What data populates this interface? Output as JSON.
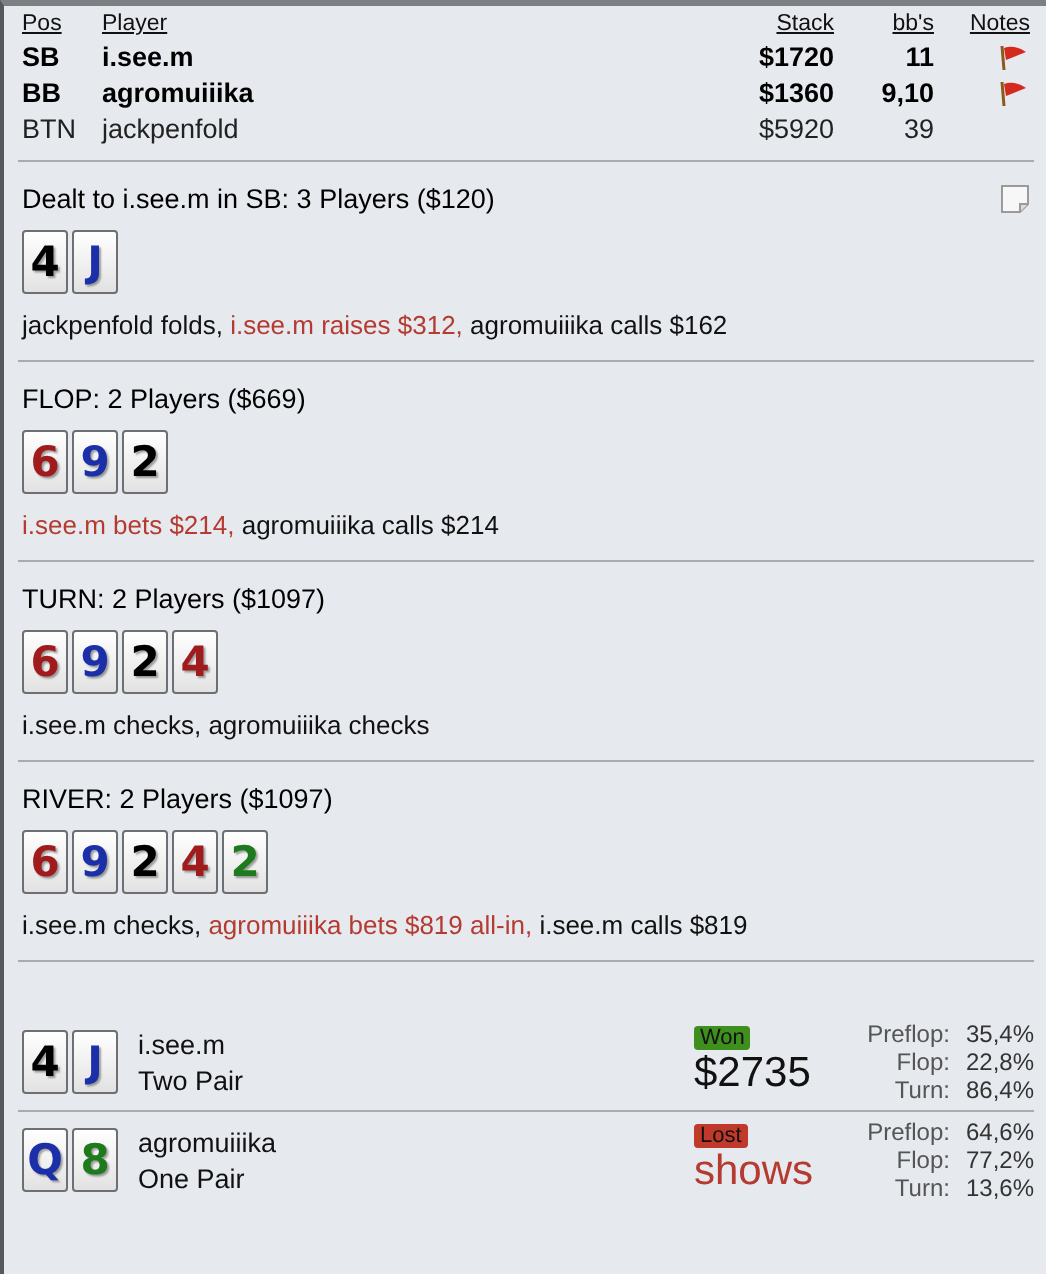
{
  "players_table": {
    "columns": [
      "Pos",
      "Player",
      "Stack",
      "bb's",
      "Notes"
    ],
    "rows": [
      {
        "pos": "SB",
        "player": "i.see.m",
        "stack": "$1720",
        "bbs": "11",
        "highlighted": true,
        "note": true
      },
      {
        "pos": "BB",
        "player": "agromuiiika",
        "stack": "$1360",
        "bbs": "9,10",
        "highlighted": true,
        "note": true
      },
      {
        "pos": "BTN",
        "player": "jackpenfold",
        "stack": "$5920",
        "bbs": "39",
        "highlighted": false,
        "note": false
      }
    ]
  },
  "streets": [
    {
      "heading": "Dealt to i.see.m in SB: 3 Players ($120)",
      "note_icon": true,
      "cards": [
        {
          "rank": "4",
          "color": "#000000"
        },
        {
          "rank": "J",
          "color": "#1a2fa8"
        }
      ],
      "actions": [
        {
          "text": "jackpenfold folds, ",
          "highlighted": false
        },
        {
          "text": "i.see.m raises $312,",
          "highlighted": true
        },
        {
          "text": " agromuiiika calls $162",
          "highlighted": false
        }
      ]
    },
    {
      "heading": "FLOP: 2 Players ($669)",
      "note_icon": false,
      "cards": [
        {
          "rank": "6",
          "color": "#a01c1c"
        },
        {
          "rank": "9",
          "color": "#1a2fa8"
        },
        {
          "rank": "2",
          "color": "#000000"
        }
      ],
      "actions": [
        {
          "text": "i.see.m bets $214,",
          "highlighted": true
        },
        {
          "text": " agromuiiika calls $214",
          "highlighted": false
        }
      ]
    },
    {
      "heading": "TURN: 2 Players ($1097)",
      "note_icon": false,
      "cards": [
        {
          "rank": "6",
          "color": "#a01c1c"
        },
        {
          "rank": "9",
          "color": "#1a2fa8"
        },
        {
          "rank": "2",
          "color": "#000000"
        },
        {
          "rank": "4",
          "color": "#a01c1c"
        }
      ],
      "actions": [
        {
          "text": "i.see.m checks, agromuiiika checks",
          "highlighted": false
        }
      ]
    },
    {
      "heading": "RIVER: 2 Players ($1097)",
      "note_icon": false,
      "cards": [
        {
          "rank": "6",
          "color": "#a01c1c"
        },
        {
          "rank": "9",
          "color": "#1a2fa8"
        },
        {
          "rank": "2",
          "color": "#000000"
        },
        {
          "rank": "4",
          "color": "#a01c1c"
        },
        {
          "rank": "2",
          "color": "#1d7a1d"
        }
      ],
      "actions": [
        {
          "text": "i.see.m checks, ",
          "highlighted": false
        },
        {
          "text": "agromuiiika bets $819 all-in,",
          "highlighted": true
        },
        {
          "text": " i.see.m calls $819",
          "highlighted": false
        }
      ]
    }
  ],
  "results": [
    {
      "cards": [
        {
          "rank": "4",
          "color": "#000000"
        },
        {
          "rank": "J",
          "color": "#1a2fa8"
        }
      ],
      "player": "i.see.m",
      "hand": "Two Pair",
      "result": {
        "kind": "won",
        "label": "Won"
      },
      "amount": "$2735",
      "equity": [
        {
          "label": "Preflop:",
          "value": "35,4%"
        },
        {
          "label": "Flop:",
          "value": "22,8%"
        },
        {
          "label": "Turn:",
          "value": "86,4%"
        }
      ]
    },
    {
      "cards": [
        {
          "rank": "Q",
          "color": "#1a2fa8"
        },
        {
          "rank": "8",
          "color": "#1d7a1d"
        }
      ],
      "player": "agromuiiika",
      "hand": "One Pair",
      "result": {
        "kind": "lost",
        "label": "Lost"
      },
      "amount": "shows",
      "equity": [
        {
          "label": "Preflop:",
          "value": "64,6%"
        },
        {
          "label": "Flop:",
          "value": "77,2%"
        },
        {
          "label": "Turn:",
          "value": "13,6%"
        }
      ]
    }
  ]
}
